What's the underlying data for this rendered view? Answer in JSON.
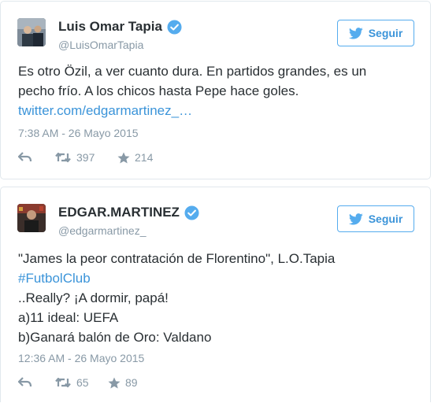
{
  "tweets": [
    {
      "name": "Luis Omar Tapia",
      "handle": "@LuisOmarTapia",
      "follow_label": "Seguir",
      "text_lines": [
        "Es otro Özil, a ver cuanto dura. En partidos grandes, es un",
        "pecho frío. A los chicos hasta Pepe hace goles."
      ],
      "link": "twitter.com/edgarmartinez_…",
      "time": "7:38 AM - 26 Mayo 2015",
      "retweets": "397",
      "favorites": "214"
    },
    {
      "name": "EDGAR.MARTINEZ",
      "handle": "@edgarmartinez_",
      "follow_label": "Seguir",
      "text_lines": [
        "\"James la peor contratación de Florentino\", L.O.Tapia",
        "#FutbolClub",
        "..Really? ¡A dormir, papá!",
        "a)11 ideal: UEFA",
        "b)Ganará balón de Oro: Valdano"
      ],
      "time": "12:36 AM - 26 Mayo 2015",
      "retweets": "65",
      "favorites": "89"
    }
  ],
  "colors": {
    "accent": "#55acee",
    "link": "#3b94d9",
    "muted": "#8899a6",
    "border": "#e1e8ed"
  },
  "icons": [
    "verified-badge-icon",
    "twitter-bird-icon",
    "reply-icon",
    "retweet-icon",
    "favorite-star-icon"
  ]
}
